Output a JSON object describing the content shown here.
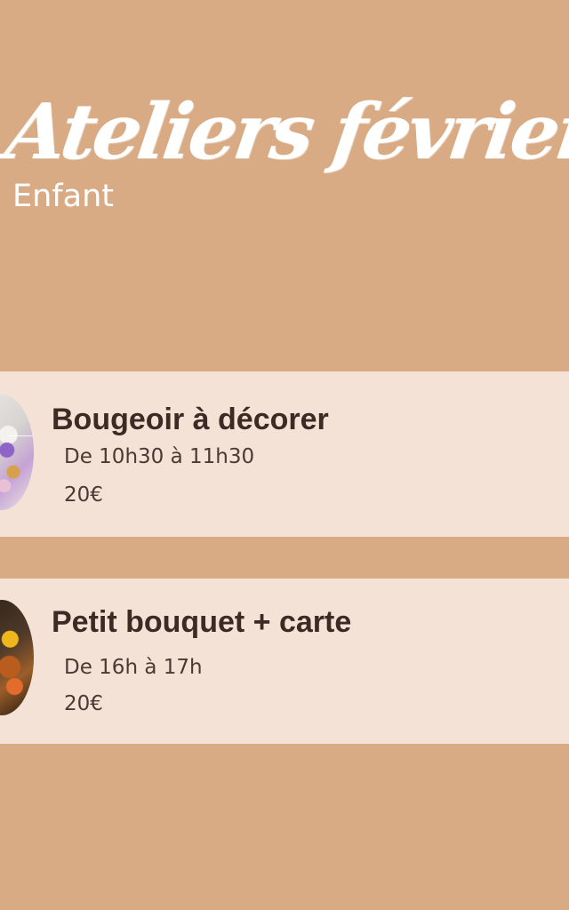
{
  "header": {
    "title": "Ateliers février",
    "subtitle": "Enfant"
  },
  "workshops": [
    {
      "title": "Bougeoir à décorer",
      "time": "De 10h30 à 11h30",
      "price": "20€",
      "image_icon": "decorated-candle-holder-image"
    },
    {
      "title": "Petit bouquet + carte",
      "time": "De 16h à 17h",
      "price": "20€",
      "image_icon": "small-bouquet-image"
    }
  ],
  "colors": {
    "background": "#d9ab84",
    "card_background": "#f4e2d6",
    "title_text": "#ffffff",
    "card_text": "#3c2a24"
  }
}
